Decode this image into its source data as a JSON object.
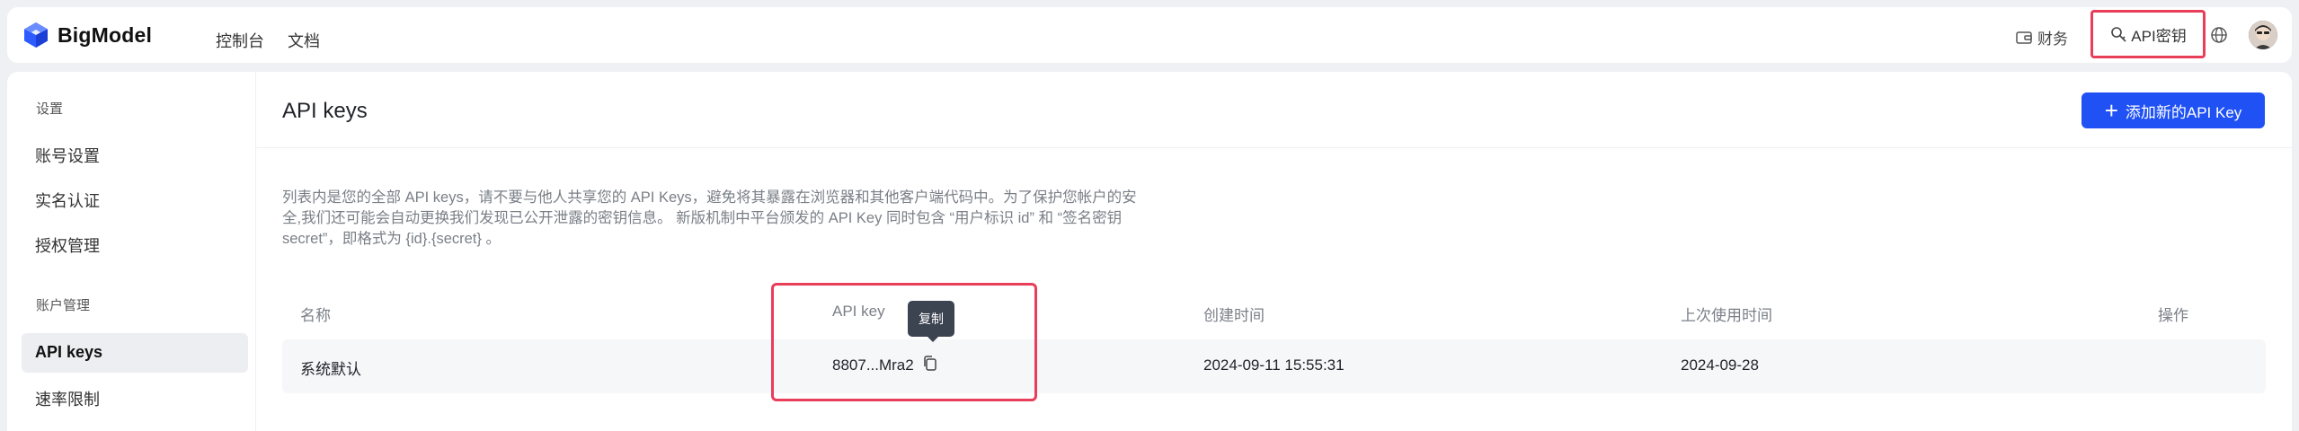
{
  "header": {
    "brand": "BigModel",
    "nav": [
      "控制台",
      "文档"
    ],
    "finance_label": "财务",
    "apikey_label": "API密钥"
  },
  "sidebar": {
    "groups": [
      {
        "title": "设置",
        "items": [
          "账号设置",
          "实名认证",
          "授权管理"
        ]
      },
      {
        "title": "账户管理",
        "items": [
          "API keys",
          "速率限制"
        ]
      }
    ],
    "active_item": "API keys"
  },
  "main": {
    "title": "API keys",
    "add_button_label": "添加新的API Key",
    "description": "列表内是您的全部 API keys，请不要与他人共享您的 API Keys，避免将其暴露在浏览器和其他客户端代码中。为了保护您帐户的安全,我们还可能会自动更换我们发现已公开泄露的密钥信息。 新版机制中平台颁发的 API Key 同时包含 “用户标识 id” 和 “签名密钥 secret”，即格式为 {id}.{secret} 。",
    "table": {
      "columns": [
        "名称",
        "API key",
        "创建时间",
        "上次使用时间",
        "操作"
      ],
      "rows": [
        {
          "name": "系统默认",
          "api_key": "8807...Mra2",
          "created": "2024-09-11 15:55:31",
          "last_used": "2024-09-28"
        }
      ]
    },
    "tooltip": "复制"
  },
  "colors": {
    "accent": "#1f51f5",
    "highlight": "#e83e5a"
  }
}
